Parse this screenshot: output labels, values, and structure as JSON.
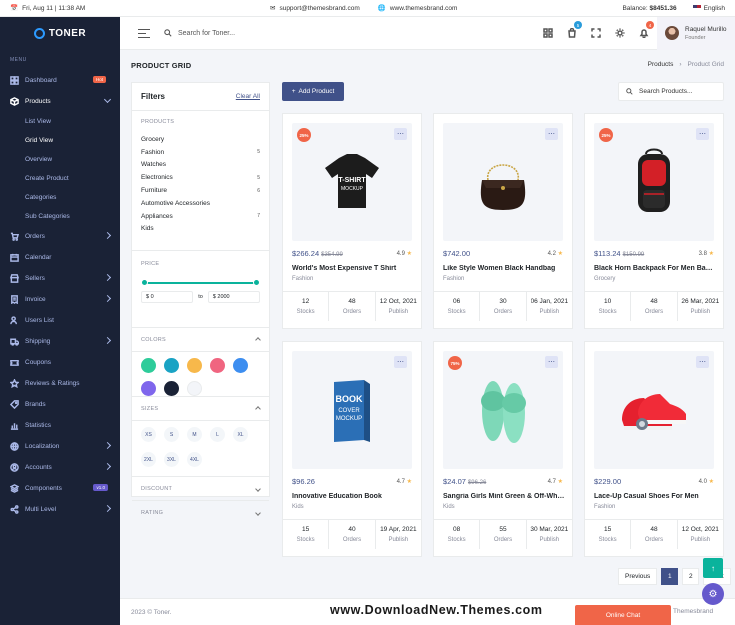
{
  "topbar": {
    "datetime": "Fri, Aug 11 | 11:38 AM",
    "email": "support@themesbrand.com",
    "website": "www.themesbrand.com",
    "balance_label": "Balance:",
    "balance_value": "$8451.36",
    "language": "English"
  },
  "sidebar": {
    "brand": "TONER",
    "menu_title": "MENU",
    "items": [
      {
        "label": "Dashboard",
        "icon": "dashboard-icon",
        "badge": "Hot"
      },
      {
        "label": "Products",
        "icon": "box-icon"
      },
      {
        "label": "Orders",
        "icon": "cart-icon"
      },
      {
        "label": "Calendar",
        "icon": "calendar-icon"
      },
      {
        "label": "Sellers",
        "icon": "store-icon"
      },
      {
        "label": "Invoice",
        "icon": "invoice-icon"
      },
      {
        "label": "Users List",
        "icon": "users-icon"
      },
      {
        "label": "Shipping",
        "icon": "truck-icon"
      },
      {
        "label": "Coupons",
        "icon": "ticket-icon"
      },
      {
        "label": "Reviews & Ratings",
        "icon": "star-icon"
      },
      {
        "label": "Brands",
        "icon": "brand-icon"
      },
      {
        "label": "Statistics",
        "icon": "chart-icon"
      },
      {
        "label": "Localization",
        "icon": "globe-icon"
      },
      {
        "label": "Accounts",
        "icon": "account-icon"
      },
      {
        "label": "Components",
        "icon": "layers-icon",
        "badge": "v1.0"
      },
      {
        "label": "Multi Level",
        "icon": "share-icon"
      }
    ],
    "product_sub": [
      "List View",
      "Grid View",
      "Overview",
      "Create Product",
      "Categories",
      "Sub Categories"
    ]
  },
  "header": {
    "search_placeholder": "Search for Toner...",
    "cart_count": "5",
    "notif_count": "4",
    "user_name": "Raquel Murillo",
    "user_role": "Founder"
  },
  "page": {
    "title": "PRODUCT GRID",
    "breadcrumb": [
      "Products",
      "Product Grid"
    ],
    "add_button": "Add Product",
    "search_placeholder": "Search Products..."
  },
  "filters": {
    "title": "Filters",
    "clear": "Clear All",
    "products_title": "PRODUCTS",
    "products": [
      {
        "name": "Grocery",
        "count": ""
      },
      {
        "name": "Fashion",
        "count": "5"
      },
      {
        "name": "Watches",
        "count": ""
      },
      {
        "name": "Electronics",
        "count": "5"
      },
      {
        "name": "Furniture",
        "count": "6"
      },
      {
        "name": "Automotive Accessories",
        "count": ""
      },
      {
        "name": "Appliances",
        "count": "7"
      },
      {
        "name": "Kids",
        "count": ""
      }
    ],
    "price_title": "PRICE",
    "price_min": "$ 0",
    "price_to": "to",
    "price_max": "$ 2000",
    "colors_title": "COLORS",
    "colors": [
      "#2ecc9a",
      "#1aa3c4",
      "#f7b84b",
      "#f06580",
      "#3d8ef0",
      "#7f66ec",
      "#1a2236",
      "#f3f5f9"
    ],
    "sizes_title": "SIZES",
    "sizes": [
      "XS",
      "S",
      "M",
      "L",
      "XL",
      "2XL",
      "3XL",
      "4XL"
    ],
    "discount_title": "DISCOUNT",
    "rating_title": "RATING"
  },
  "products": [
    {
      "price": "$266.24",
      "old": "$354.99",
      "rating": "4.9",
      "name": "World's Most Expensive T Shirt",
      "category": "Fashion",
      "stocks": "12",
      "orders": "48",
      "publish": "12 Oct, 2021",
      "discount": "25%",
      "image": "tshirt-image"
    },
    {
      "price": "$742.00",
      "old": "",
      "rating": "4.2",
      "name": "Like Style Women Black Handbag",
      "category": "Fashion",
      "stocks": "06",
      "orders": "30",
      "publish": "06 Jan, 2021",
      "discount": "",
      "image": "handbag-image"
    },
    {
      "price": "$113.24",
      "old": "$150.99",
      "rating": "3.8",
      "name": "Black Horn Backpack For Men Bags 30 L",
      "category": "Grocery",
      "stocks": "10",
      "orders": "48",
      "publish": "26 Mar, 2021",
      "discount": "25%",
      "image": "backpack-image"
    },
    {
      "price": "$96.26",
      "old": "",
      "rating": "4.7",
      "name": "Innovative Education Book",
      "category": "Kids",
      "stocks": "15",
      "orders": "40",
      "publish": "19 Apr, 2021",
      "discount": "",
      "image": "book-image"
    },
    {
      "price": "$24.07",
      "old": "$96.26",
      "rating": "4.7",
      "name": "Sangria Girls Mint Green & Off-White Solid Open Toe Flats",
      "category": "Kids",
      "stocks": "08",
      "orders": "55",
      "publish": "30 Mar, 2021",
      "discount": "75%",
      "image": "slippers-image"
    },
    {
      "price": "$229.00",
      "old": "",
      "rating": "4.0",
      "name": "Lace-Up Casual Shoes For Men",
      "category": "Fashion",
      "stocks": "15",
      "orders": "48",
      "publish": "12 Oct, 2021",
      "discount": "",
      "image": "shoes-image"
    }
  ],
  "labels": {
    "stocks": "Stocks",
    "orders": "Orders",
    "publish": "Publish"
  },
  "pagination": {
    "prev": "Previous",
    "pages": [
      "1",
      "2"
    ],
    "next": "Next"
  },
  "footer": {
    "copyright": "2023 © Toner.",
    "watermark": "www.DownloadNew.Themes.com",
    "chat": "Online Chat",
    "credit": "Themesbrand"
  },
  "colors": {
    "primary": "#405189",
    "success": "#0ab39c",
    "danger": "#f06548",
    "sidebar": "#1a2236"
  }
}
